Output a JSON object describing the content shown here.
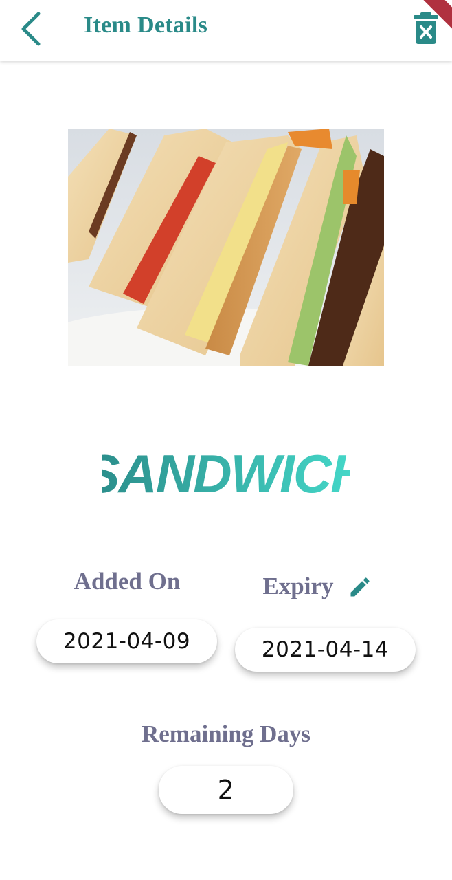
{
  "header": {
    "title": "Item Details",
    "back_icon": "chevron-left-icon",
    "delete_icon": "trash-x-icon"
  },
  "item": {
    "name": "SANDWICH",
    "image_alt": "sandwich-photo"
  },
  "added": {
    "label": "Added On",
    "value": "2021-04-09"
  },
  "expiry": {
    "label": "Expiry",
    "value": "2021-04-14",
    "edit_icon": "pencil-icon"
  },
  "remaining": {
    "label": "Remaining Days",
    "value": "2"
  },
  "colors": {
    "accent": "#2a8a88",
    "label": "#6f6f8e",
    "name_gradient_start": "#2a8a88",
    "name_gradient_end": "#46dccc"
  }
}
